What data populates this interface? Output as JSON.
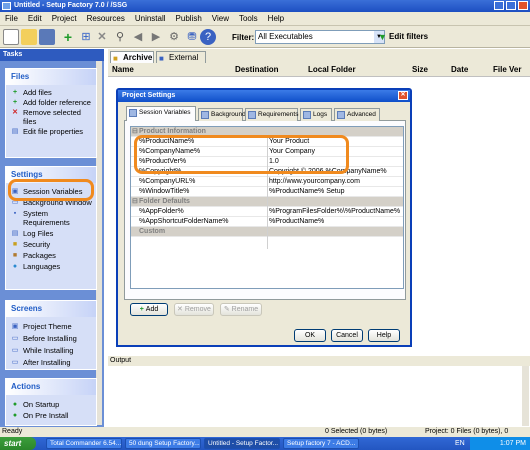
{
  "window": {
    "title": "Untitled - Setup Factory 7.0 / /SSG"
  },
  "menu": [
    "File",
    "Edit",
    "Project",
    "Resources",
    "Uninstall",
    "Publish",
    "View",
    "Tools",
    "Help"
  ],
  "toolbar": {
    "filter_label": "Filter:",
    "filter_value": "All Executables",
    "edit_filters": "Edit filters"
  },
  "tasks": {
    "header": "Tasks",
    "files": {
      "title": "Files",
      "items": [
        "Add files",
        "Add folder reference",
        "Remove selected files",
        "Edit file properties"
      ]
    },
    "settings": {
      "title": "Settings",
      "items": [
        "Session Variables",
        "Background Window",
        "System Requirements",
        "Log Files",
        "Security",
        "Packages",
        "Languages"
      ]
    },
    "screens": {
      "title": "Screens",
      "items": [
        "Project Theme",
        "Before Installing",
        "While Installing",
        "After Installing"
      ]
    },
    "actions": {
      "title": "Actions",
      "items": [
        "On Startup",
        "On Pre Install"
      ]
    }
  },
  "main": {
    "tabs": [
      "Archive",
      "External"
    ],
    "columns": [
      "Name",
      "Destination",
      "Local Folder",
      "Size",
      "Date",
      "File Ver"
    ],
    "output_label": "Output"
  },
  "dialog": {
    "title": "Project Settings",
    "tabs": [
      "Session Variables",
      "Background",
      "Requirements",
      "Logs",
      "Advanced"
    ],
    "categories": [
      "Product Information",
      "Folder Defaults",
      "Custom"
    ],
    "rows_product": [
      {
        "name": "%ProductName%",
        "value": "Your Product"
      },
      {
        "name": "%CompanyName%",
        "value": "Your Company"
      },
      {
        "name": "%ProductVer%",
        "value": "1.0"
      },
      {
        "name": "%Copyright%",
        "value": "Copyright © 2006 %CompanyName%"
      },
      {
        "name": "%CompanyURL%",
        "value": "http://www.yourcompany.com"
      },
      {
        "name": "%WindowTitle%",
        "value": "%ProductName% Setup"
      }
    ],
    "rows_folder": [
      {
        "name": "%AppFolder%",
        "value": "%ProgramFilesFolder%\\%ProductName%"
      },
      {
        "name": "%AppShortcutFolderName%",
        "value": "%ProductName%"
      }
    ],
    "buttons": {
      "add": "Add",
      "remove": "Remove",
      "rename": "Rename",
      "ok": "OK",
      "cancel": "Cancel",
      "help": "Help"
    }
  },
  "status": {
    "ready": "Ready",
    "selected": "0 Selected (0 bytes)",
    "project": "Project: 0 Files (0 bytes), 0 Folders"
  },
  "taskbar": {
    "start": "start",
    "items": [
      "Total Commander 6.54...",
      "50 dung Setup Factory...",
      "Untitled - Setup Factor...",
      "Setup factory 7 - ACD..."
    ],
    "lang": "EN",
    "time": "1:07 PM"
  }
}
